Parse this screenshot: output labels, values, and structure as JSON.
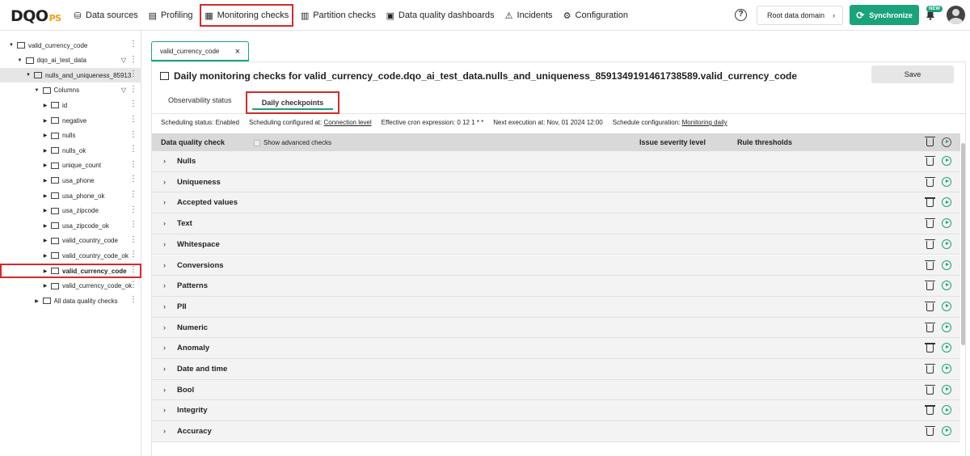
{
  "app": {
    "logo_main": "DQO",
    "logo_suffix": "PS"
  },
  "nav": [
    {
      "label": "Data sources",
      "icon": "database-icon"
    },
    {
      "label": "Profiling",
      "icon": "profiling-icon"
    },
    {
      "label": "Monitoring checks",
      "icon": "monitoring-icon",
      "highlighted": true
    },
    {
      "label": "Partition checks",
      "icon": "partition-icon"
    },
    {
      "label": "Data quality dashboards",
      "icon": "dashboard-icon"
    },
    {
      "label": "Incidents",
      "icon": "warning-icon"
    },
    {
      "label": "Configuration",
      "icon": "gear-icon"
    }
  ],
  "header_right": {
    "help": "?",
    "root_domain": "Root data domain",
    "sync": "Synchronize",
    "new_badge": "NEW"
  },
  "tree": [
    {
      "label": "valid_currency_code",
      "indent": 0,
      "expanded": true,
      "kebab": true
    },
    {
      "label": "dqo_ai_test_data",
      "indent": 1,
      "expanded": true,
      "kebab": true,
      "filter": true
    },
    {
      "label": "nulls_and_uniqueness_85913",
      "indent": 2,
      "expanded": true,
      "kebab": true,
      "selected": true
    },
    {
      "label": "Columns",
      "indent": 3,
      "expanded": true,
      "kebab": true,
      "filter": true
    },
    {
      "label": "id",
      "indent": 4,
      "kebab": true
    },
    {
      "label": "negative",
      "indent": 4,
      "kebab": true
    },
    {
      "label": "nulls",
      "indent": 4,
      "kebab": true
    },
    {
      "label": "nulls_ok",
      "indent": 4,
      "kebab": true
    },
    {
      "label": "unique_count",
      "indent": 4,
      "kebab": true
    },
    {
      "label": "usa_phone",
      "indent": 4,
      "kebab": true
    },
    {
      "label": "usa_phone_ok",
      "indent": 4,
      "kebab": true
    },
    {
      "label": "usa_zipcode",
      "indent": 4,
      "kebab": true
    },
    {
      "label": "usa_zipcode_ok",
      "indent": 4,
      "kebab": true
    },
    {
      "label": "valid_country_code",
      "indent": 4,
      "kebab": true
    },
    {
      "label": "valid_country_code_ok",
      "indent": 4,
      "kebab": true
    },
    {
      "label": "valid_currency_code",
      "indent": 4,
      "kebab": true,
      "boxed": true,
      "bold": true
    },
    {
      "label": "valid_currency_code_ok",
      "indent": 4,
      "kebab": true
    },
    {
      "label": "All data quality checks",
      "indent": 3,
      "kebab": true
    }
  ],
  "tab": {
    "label": "valid_currency_code",
    "close": "×"
  },
  "heading": "Daily monitoring checks for valid_currency_code.dqo_ai_test_data.nulls_and_uniqueness_8591349191461738589.valid_currency_code",
  "save": "Save",
  "subtabs": {
    "observability": "Observability status",
    "daily": "Daily checkpoints"
  },
  "status": {
    "scheduling_status": "Scheduling status: Enabled",
    "configured_at_label": "Scheduling configured at:",
    "configured_at_link": "Connection level",
    "cron": "Effective cron expression: 0 12 1 * *",
    "next_exec": "Next execution at: Nov, 01 2024 12:00",
    "schedule_config_label": "Schedule configuration:",
    "schedule_config_link": "Monitoring daily"
  },
  "table": {
    "col_check": "Data quality check",
    "show_advanced": "Show advanced checks",
    "col_severity": "Issue severity level",
    "col_thresholds": "Rule thresholds"
  },
  "categories": [
    "Nulls",
    "Uniqueness",
    "Accepted values",
    "Text",
    "Whitespace",
    "Conversions",
    "Patterns",
    "PII",
    "Numeric",
    "Anomaly",
    "Date and time",
    "Bool",
    "Integrity",
    "Accuracy"
  ],
  "colors": {
    "accent": "#1aa37a",
    "highlight": "#d62828"
  }
}
